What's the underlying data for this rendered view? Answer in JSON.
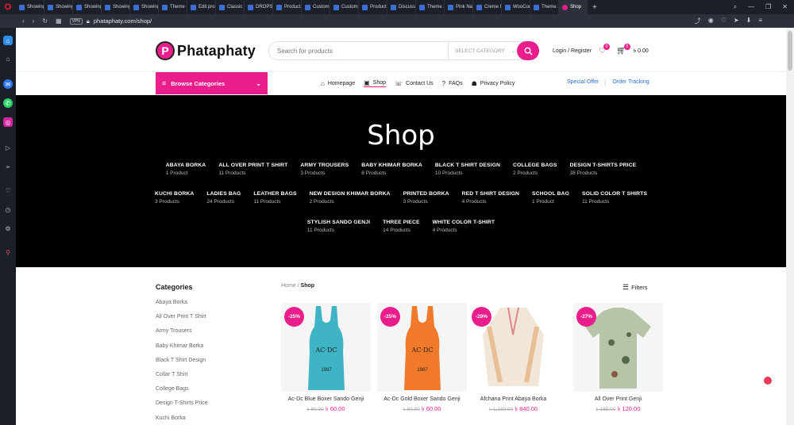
{
  "browser": {
    "tabs": [
      "Showing",
      "Showing",
      "Showing",
      "Showing",
      "Showing",
      "Theme S",
      "Edit pro",
      "Classic w",
      "DROPS 8",
      "Products",
      "Customi",
      "Customi",
      "Product",
      "Discussio",
      "Theme S",
      "Pink Nail",
      "Creme N",
      "WooCom",
      "Theme S",
      "Shop"
    ],
    "active_tab_index": 19,
    "url": "phataphaty.com/shop/"
  },
  "header": {
    "logo": "Phataphaty",
    "logo_mark": "P",
    "search_placeholder": "Search for products",
    "select_category": "SELECT CATEGORY",
    "login": "Login / Register",
    "wishlist_count": "0",
    "cart_count": "0",
    "cart_total": "৳ 0.00"
  },
  "nav": {
    "browse": "Browse Categories",
    "menu": [
      {
        "label": "Homepage",
        "icon": "home-icon"
      },
      {
        "label": "Shop",
        "icon": "shop-icon"
      },
      {
        "label": "Contact Us",
        "icon": "contact-icon"
      },
      {
        "label": "FAQs",
        "icon": "question-icon"
      },
      {
        "label": "Privacy Policy",
        "icon": "users-icon"
      }
    ],
    "special_offer": "Special Offer",
    "order_tracking": "Order Tracking"
  },
  "hero": {
    "title": "Shop",
    "rows": [
      [
        {
          "name": "ABAYA BORKA",
          "count": "1 Product"
        },
        {
          "name": "ALL OVER PRINT T SHIRT",
          "count": "11 Products"
        },
        {
          "name": "ARMY TROUSERS",
          "count": "3 Products"
        },
        {
          "name": "BABY KHIMAR BORKA",
          "count": "8 Products"
        },
        {
          "name": "BLACK T SHIRT DESIGN",
          "count": "10 Products"
        },
        {
          "name": "COLLEGE BAGS",
          "count": "2 Products"
        },
        {
          "name": "DESIGN T-SHIRTS PRICE",
          "count": "38 Products"
        }
      ],
      [
        {
          "name": "KUCHI BORKA",
          "count": "3 Products"
        },
        {
          "name": "LADIES BAG",
          "count": "24 Products"
        },
        {
          "name": "LEATHER BAGS",
          "count": "11 Products"
        },
        {
          "name": "NEW DESIGN KHIMAR BORKA",
          "count": "2 Products"
        },
        {
          "name": "PRINTED BORKA",
          "count": "3 Products"
        },
        {
          "name": "RED T SHIRT DESIGN",
          "count": "4 Products"
        },
        {
          "name": "SCHOOL BAG",
          "count": "1 Product"
        },
        {
          "name": "SOLID COLOR T SHIRTS",
          "count": "11 Products"
        }
      ],
      [
        {
          "name": "STYLISH SANDO GENJI",
          "count": "11 Products"
        },
        {
          "name": "THREE PIECE",
          "count": "14 Products"
        },
        {
          "name": "WHITE COLOR T-SHIRT",
          "count": "4 Products"
        }
      ]
    ]
  },
  "sidebar": {
    "title": "Categories",
    "items": [
      "Abaya Borka",
      "All Over Print T Shirt",
      "Army Trousers",
      "Baby Khimar Borka",
      "Black T Shirt Design",
      "Collar T Shirt",
      "College Bags",
      "Design T-Shirts Price",
      "Kuchi Borka"
    ]
  },
  "breadcrumb": {
    "home": "Home",
    "sep": "/",
    "current": "Shop"
  },
  "filters_label": "Filters",
  "products": [
    {
      "discount": "-25%",
      "name": "Ac-Dc Blue Boxer Sando Genji",
      "old": "৳ 80.00",
      "new": "৳ 60.00",
      "color": "#3fb4c4"
    },
    {
      "discount": "-25%",
      "name": "Ac-Dc Gold Boxer Sando Genji",
      "old": "৳ 80.00",
      "new": "৳ 60.00",
      "color": "#f07a2a"
    },
    {
      "discount": "-29%",
      "name": "Afchana Print Abaya Borka",
      "old": "৳ 1,180.00",
      "new": "৳ 840.00",
      "color": "#f2e6d8"
    },
    {
      "discount": "-27%",
      "name": "All Over Print Genji",
      "old": "৳ 165.00",
      "new": "৳ 120.00",
      "color": "#b7c4a6"
    }
  ],
  "accent": "#e91e8c"
}
